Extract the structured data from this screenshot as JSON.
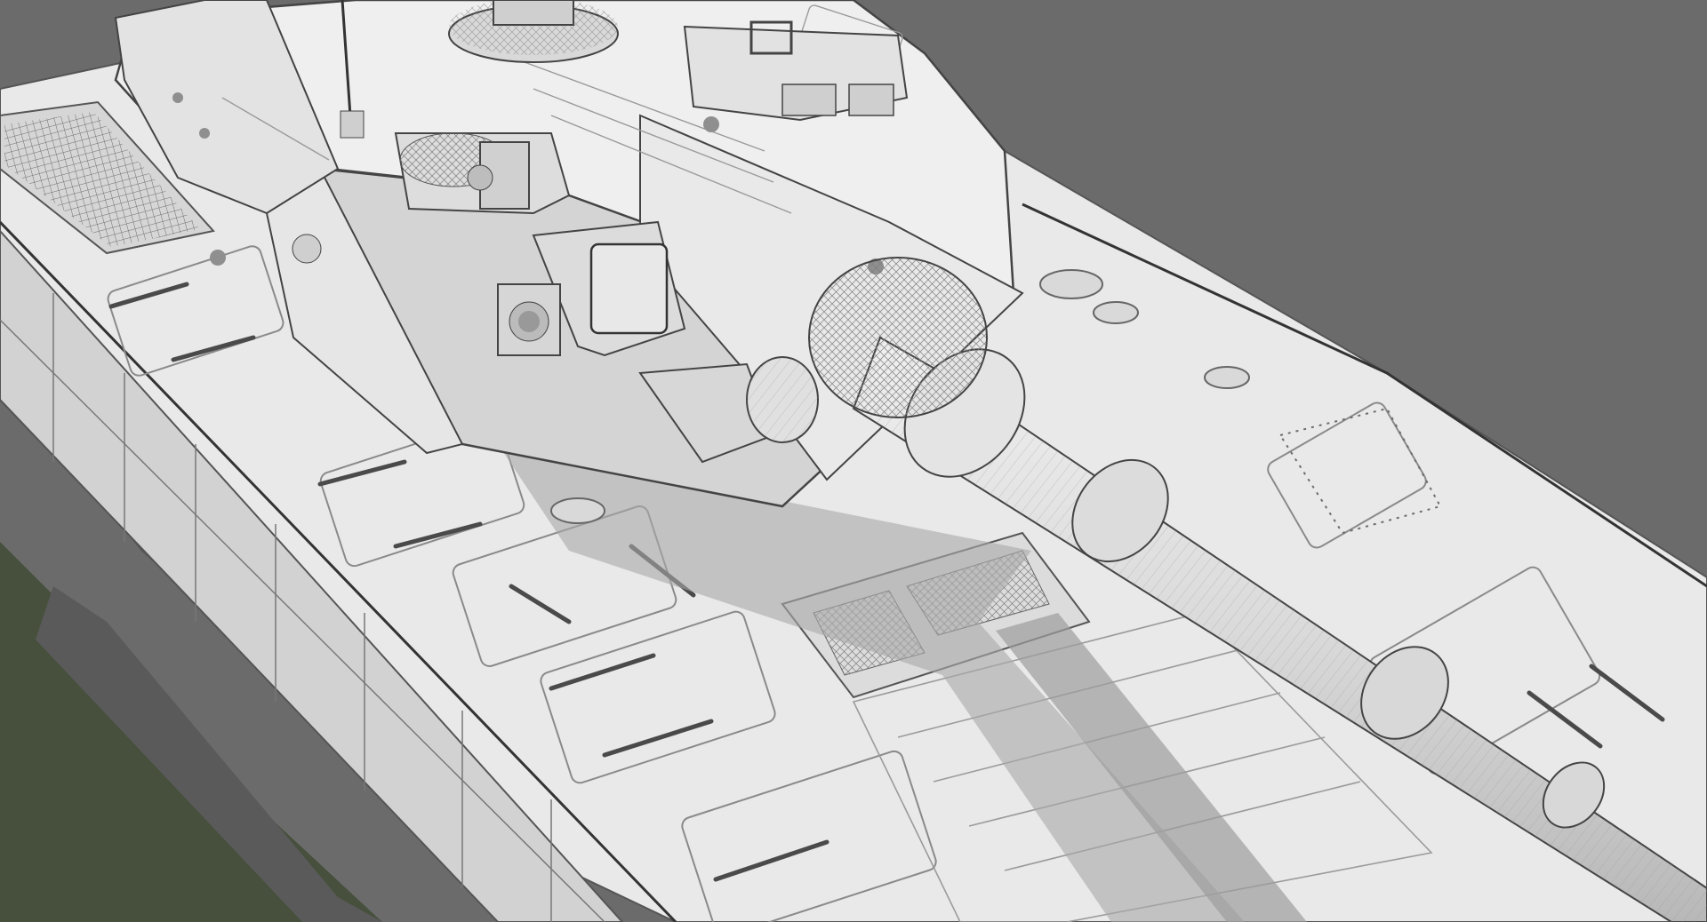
{
  "image": {
    "subject": "tank-3d-model-wireframe-render",
    "colors": {
      "background": "#6b6b6b",
      "hull": "#e9e9e9",
      "hull_shade": "#cfcfcf",
      "hull_dark": "#b9b9b9",
      "turret": "#efefef",
      "turret_shade": "#d4d4d4",
      "barrel": "#e1e1e1",
      "wire": "#8a8a8a",
      "shadow": "#a9a9a9",
      "grass": "#46503c",
      "track": "#5a5a5a"
    }
  }
}
